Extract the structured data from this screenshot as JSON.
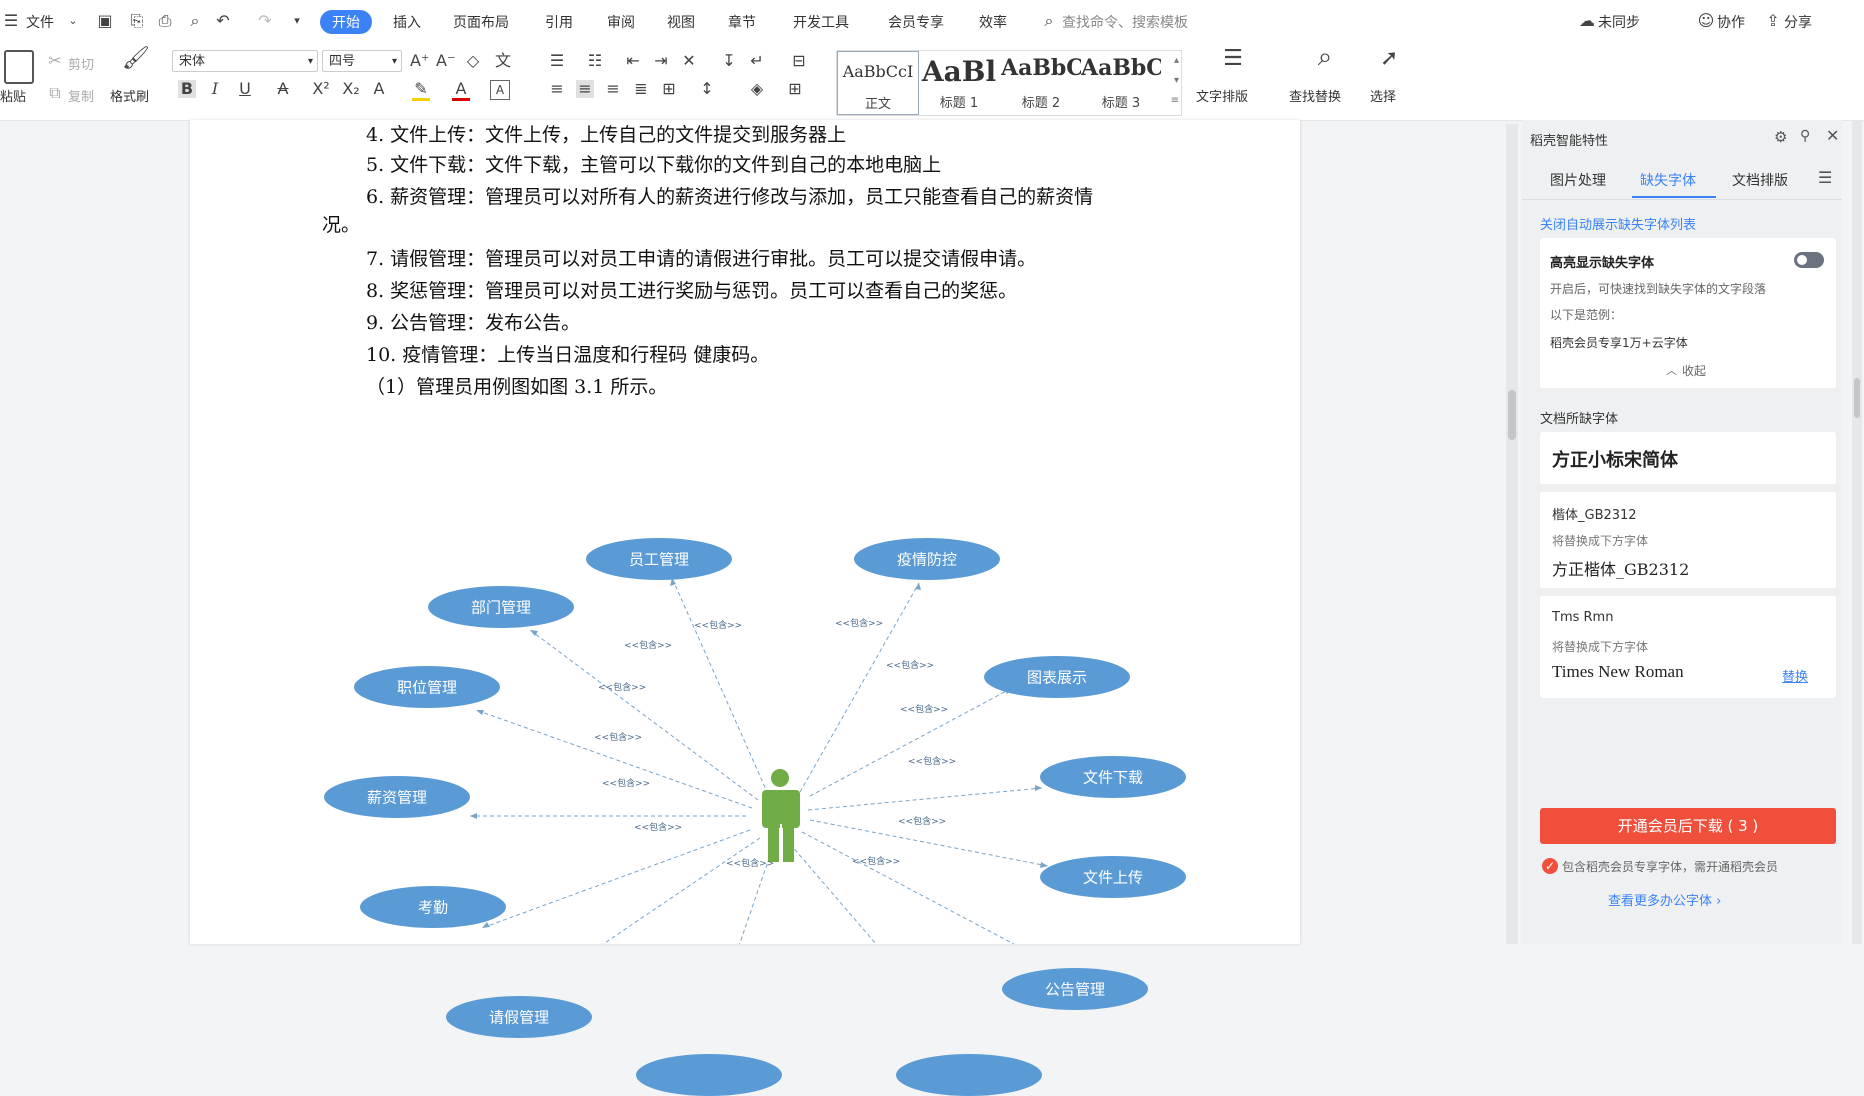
{
  "menubar": {
    "file_label": "文件",
    "tabs": [
      "开始",
      "插入",
      "页面布局",
      "引用",
      "审阅",
      "视图",
      "章节",
      "开发工具",
      "会员专享",
      "效率"
    ],
    "active_tab": "开始",
    "search_placeholder": "查找命令、搜索模板",
    "right": {
      "sync": "未同步",
      "collab": "协作",
      "share": "分享"
    }
  },
  "ribbon": {
    "paste": "粘贴",
    "cut": "剪切",
    "copy": "复制",
    "format_painter": "格式刷",
    "font_name": "宋体",
    "font_size": "四号",
    "styles": [
      {
        "sample": "AaBbCcI",
        "name": "正文"
      },
      {
        "sample": "AaBl",
        "name": "标题 1"
      },
      {
        "sample": "AaBbC",
        "name": "标题 2"
      },
      {
        "sample": "AaBbC",
        "name": "标题 3"
      }
    ],
    "text_layout": "文字排版",
    "find_replace": "查找替换",
    "select": "选择"
  },
  "document": {
    "lines": [
      "4.  文件上传：文件上传，上传自己的文件提交到服务器上",
      "5.  文件下载：文件下载，主管可以下载你的文件到自己的本地电脑上",
      "6.  薪资管理：管理员可以对所有人的薪资进行修改与添加，员工只能查看自己的薪资情",
      "况。",
      "7.  请假管理：管理员可以对员工申请的请假进行审批。员工可以提交请假申请。",
      "8.  奖惩管理：管理员可以对员工进行奖励与惩罚。员工可以查看自己的奖惩。",
      "9.  公告管理：发布公告。",
      "10. 疫情管理：上传当日温度和行程码 健康码。",
      "（1）管理员用例图如图 3.1 所示。"
    ]
  },
  "diagram": {
    "use_cases": [
      "员工管理",
      "疫情防控",
      "部门管理",
      "图表展示",
      "职位管理",
      "文件下载",
      "薪资管理",
      "文件上传",
      "考勤",
      "公告管理",
      "请假管理"
    ],
    "include_label": "<<包含>>",
    "actor_color": "#70ad47",
    "ellipse_color": "#5b9bd5"
  },
  "panel": {
    "title": "稻壳智能特性",
    "tabs": [
      "图片处理",
      "缺失字体",
      "文档排版"
    ],
    "active_tab": "缺失字体",
    "close_auto_link": "关闭自动展示缺失字体列表",
    "highlight_title": "高亮显示缺失字体",
    "highlight_desc": "开启后，可快速找到缺失字体的文字段落",
    "example_label": "以下是范例：",
    "example_text": "稻壳会员专享1万+云字体",
    "collapse": "收起",
    "missing_header": "文档所缺字体",
    "fonts": [
      {
        "missing": "方正小标宋简体"
      },
      {
        "missing": "楷体_GB2312",
        "replace_label": "将替换成下方字体",
        "replacement": "方正楷体_GB2312"
      },
      {
        "missing": "Tms Rmn",
        "replace_label": "将替换成下方字体",
        "replacement": "Times New Roman",
        "action": "替换"
      }
    ],
    "download_button": "开通会员后下载 ( 3 )",
    "note": "包含稻壳会员专享字体，需开通稻壳会员",
    "more_link": "查看更多办公字体 ›",
    "accent_color": "#3b82f6",
    "button_color": "#f04f3c"
  }
}
